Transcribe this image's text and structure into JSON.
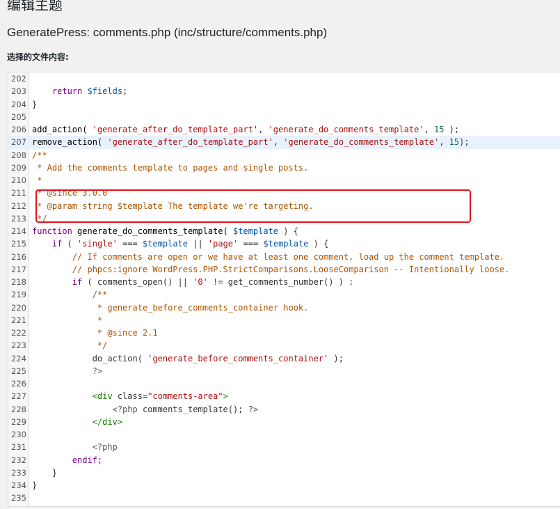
{
  "page": {
    "heading": "编辑主题",
    "file_title": "GeneratePress: comments.php (inc/structure/comments.php)",
    "content_label": "选择的文件内容:"
  },
  "editor": {
    "active_line": "207",
    "highlight_color": "#e0151c",
    "lines": [
      {
        "n": "202",
        "tokens": []
      },
      {
        "n": "203",
        "tokens": [
          {
            "t": "    ",
            "c": "c-pl"
          },
          {
            "t": "return",
            "c": "c-kw"
          },
          {
            "t": " ",
            "c": "c-pl"
          },
          {
            "t": "$fields",
            "c": "c-var"
          },
          {
            "t": ";",
            "c": "c-pl"
          }
        ]
      },
      {
        "n": "204",
        "tokens": [
          {
            "t": "}",
            "c": "c-pl"
          }
        ]
      },
      {
        "n": "205",
        "tokens": []
      },
      {
        "n": "206",
        "tokens": [
          {
            "t": "add_action( ",
            "c": "c-fn"
          },
          {
            "t": "'generate_after_do_template_part'",
            "c": "c-str"
          },
          {
            "t": ", ",
            "c": "c-pl"
          },
          {
            "t": "'generate_do_comments_template'",
            "c": "c-str"
          },
          {
            "t": ", ",
            "c": "c-pl"
          },
          {
            "t": "15",
            "c": "c-num"
          },
          {
            "t": " );",
            "c": "c-pl"
          }
        ]
      },
      {
        "n": "207",
        "tokens": [
          {
            "t": "remove_action( ",
            "c": "c-fn"
          },
          {
            "t": "'generate_after_do_template_part'",
            "c": "c-str"
          },
          {
            "t": ", ",
            "c": "c-pl"
          },
          {
            "t": "'generate_do_comments_template'",
            "c": "c-str"
          },
          {
            "t": ", ",
            "c": "c-pl"
          },
          {
            "t": "15",
            "c": "c-num"
          },
          {
            "t": ");",
            "c": "c-pl"
          }
        ]
      },
      {
        "n": "208",
        "tokens": [
          {
            "t": "/**",
            "c": "c-com"
          }
        ]
      },
      {
        "n": "209",
        "tokens": [
          {
            "t": " * Add the comments template to pages and single posts.",
            "c": "c-com"
          }
        ]
      },
      {
        "n": "210",
        "tokens": [
          {
            "t": " *",
            "c": "c-com"
          }
        ]
      },
      {
        "n": "211",
        "tokens": [
          {
            "t": " * @since 3.0.0",
            "c": "c-com"
          }
        ]
      },
      {
        "n": "212",
        "tokens": [
          {
            "t": " * @param string $template The template we're targeting.",
            "c": "c-com"
          }
        ]
      },
      {
        "n": "213",
        "tokens": [
          {
            "t": " */",
            "c": "c-com"
          }
        ]
      },
      {
        "n": "214",
        "tokens": [
          {
            "t": "function",
            "c": "c-kw"
          },
          {
            "t": " generate_do_comments_template( ",
            "c": "c-fn"
          },
          {
            "t": "$template",
            "c": "c-var"
          },
          {
            "t": " ) {",
            "c": "c-pl"
          }
        ]
      },
      {
        "n": "215",
        "tokens": [
          {
            "t": "    ",
            "c": "c-pl"
          },
          {
            "t": "if",
            "c": "c-kw"
          },
          {
            "t": " ( ",
            "c": "c-pl"
          },
          {
            "t": "'single'",
            "c": "c-str"
          },
          {
            "t": " === ",
            "c": "c-pl"
          },
          {
            "t": "$template",
            "c": "c-var"
          },
          {
            "t": " || ",
            "c": "c-pl"
          },
          {
            "t": "'page'",
            "c": "c-str"
          },
          {
            "t": " === ",
            "c": "c-pl"
          },
          {
            "t": "$template",
            "c": "c-var"
          },
          {
            "t": " ) {",
            "c": "c-pl"
          }
        ]
      },
      {
        "n": "216",
        "tokens": [
          {
            "t": "        ",
            "c": "c-pl"
          },
          {
            "t": "// If comments are open or we have at least one comment, load up the comment template.",
            "c": "c-com"
          }
        ]
      },
      {
        "n": "217",
        "tokens": [
          {
            "t": "        ",
            "c": "c-pl"
          },
          {
            "t": "// phpcs:ignore WordPress.PHP.StrictComparisons.LooseComparison -- Intentionally loose.",
            "c": "c-com"
          }
        ]
      },
      {
        "n": "218",
        "tokens": [
          {
            "t": "        ",
            "c": "c-pl"
          },
          {
            "t": "if",
            "c": "c-kw"
          },
          {
            "t": " ( comments_open() || ",
            "c": "c-pl"
          },
          {
            "t": "'0'",
            "c": "c-str"
          },
          {
            "t": " != get_comments_number() ) :",
            "c": "c-pl"
          }
        ]
      },
      {
        "n": "219",
        "tokens": [
          {
            "t": "            /**",
            "c": "c-com"
          }
        ]
      },
      {
        "n": "220",
        "tokens": [
          {
            "t": "             * generate_before_comments_container hook.",
            "c": "c-com"
          }
        ]
      },
      {
        "n": "221",
        "tokens": [
          {
            "t": "             *",
            "c": "c-com"
          }
        ]
      },
      {
        "n": "222",
        "tokens": [
          {
            "t": "             * @since 2.1",
            "c": "c-com"
          }
        ]
      },
      {
        "n": "223",
        "tokens": [
          {
            "t": "             */",
            "c": "c-com"
          }
        ]
      },
      {
        "n": "224",
        "tokens": [
          {
            "t": "            do_action( ",
            "c": "c-pl"
          },
          {
            "t": "'generate_before_comments_container'",
            "c": "c-str"
          },
          {
            "t": " );",
            "c": "c-pl"
          }
        ]
      },
      {
        "n": "225",
        "tokens": [
          {
            "t": "            ?>",
            "c": "c-meta"
          }
        ]
      },
      {
        "n": "226",
        "tokens": []
      },
      {
        "n": "227",
        "tokens": [
          {
            "t": "            ",
            "c": "c-pl"
          },
          {
            "t": "<div",
            "c": "c-tag"
          },
          {
            "t": " class=",
            "c": "c-pl"
          },
          {
            "t": "\"comments-area\"",
            "c": "c-str"
          },
          {
            "t": ">",
            "c": "c-tag"
          }
        ]
      },
      {
        "n": "228",
        "tokens": [
          {
            "t": "                ",
            "c": "c-pl"
          },
          {
            "t": "<?php",
            "c": "c-meta"
          },
          {
            "t": " comments_template(); ",
            "c": "c-pl"
          },
          {
            "t": "?>",
            "c": "c-meta"
          }
        ]
      },
      {
        "n": "229",
        "tokens": [
          {
            "t": "            ",
            "c": "c-pl"
          },
          {
            "t": "</div>",
            "c": "c-tag"
          }
        ]
      },
      {
        "n": "230",
        "tokens": []
      },
      {
        "n": "231",
        "tokens": [
          {
            "t": "            ",
            "c": "c-pl"
          },
          {
            "t": "<?php",
            "c": "c-meta"
          }
        ]
      },
      {
        "n": "232",
        "tokens": [
          {
            "t": "        ",
            "c": "c-pl"
          },
          {
            "t": "endif",
            "c": "c-kw"
          },
          {
            "t": ";",
            "c": "c-pl"
          }
        ]
      },
      {
        "n": "233",
        "tokens": [
          {
            "t": "    }",
            "c": "c-pl"
          }
        ]
      },
      {
        "n": "234",
        "tokens": [
          {
            "t": "}",
            "c": "c-pl"
          }
        ]
      },
      {
        "n": "235",
        "tokens": []
      }
    ]
  }
}
